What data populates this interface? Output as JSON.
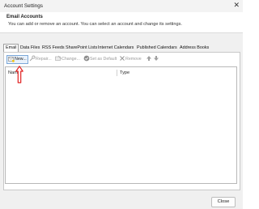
{
  "window": {
    "title": "Account Settings",
    "close_glyph": "✕"
  },
  "header": {
    "title": "Email Accounts",
    "description": "You can add or remove an account. You can select an account and change its settings."
  },
  "tabs": [
    {
      "label": "Email",
      "active": true
    },
    {
      "label": "Data Files"
    },
    {
      "label": "RSS Feeds"
    },
    {
      "label": "SharePoint Lists"
    },
    {
      "label": "Internet Calendars"
    },
    {
      "label": "Published Calendars"
    },
    {
      "label": "Address Books"
    }
  ],
  "toolbar": {
    "new": {
      "label": "New...",
      "icon": "new-account-icon"
    },
    "repair": {
      "label": "Repair...",
      "icon": "wrench-icon"
    },
    "change": {
      "label": "Change...",
      "icon": "change-icon"
    },
    "set_default": {
      "label": "Set as Default",
      "icon": "check-circle-icon"
    },
    "remove": {
      "label": "Remove",
      "icon": "x-icon"
    },
    "move_up": {
      "icon": "arrow-up-icon"
    },
    "move_down": {
      "icon": "arrow-down-icon"
    }
  },
  "list": {
    "columns": [
      "Name",
      "Type"
    ]
  },
  "annotation": {
    "icon": "red-arrow-icon",
    "color": "#e02020"
  },
  "footer": {
    "close_label": "Close"
  }
}
